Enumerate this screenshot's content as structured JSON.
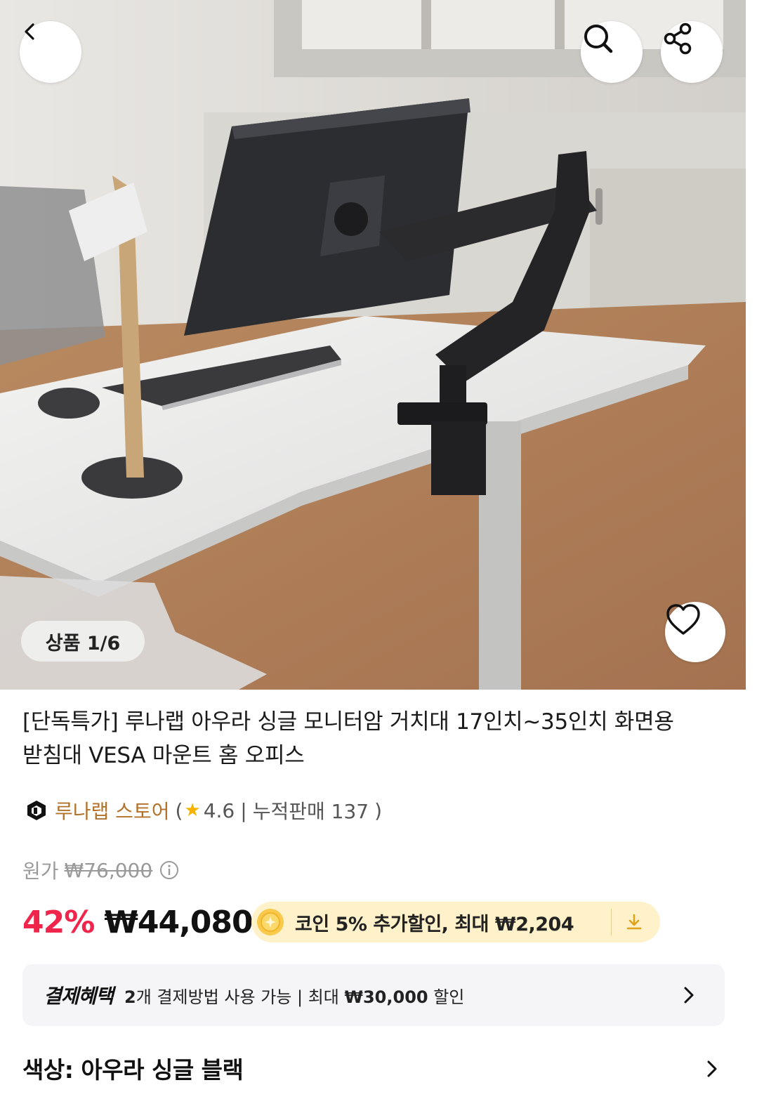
{
  "gallery": {
    "page_indicator": "상품 1/6",
    "icons": {
      "back": "back-arrow-icon",
      "search": "search-icon",
      "share": "share-icon",
      "wishlist": "heart-icon"
    }
  },
  "product": {
    "title_line1": "[단독특가] 루나랩 아우라 싱글 모니터암 거치대 17인치~35인치 화면용",
    "title_line2": "받침대 VESA 마운트 홈 오피스",
    "store": {
      "name": "루나랩 스토어",
      "open_paren": "(",
      "rating": "4.6",
      "separator": "|",
      "sales": "누적판매 137",
      "close_paren": ")"
    },
    "original_price_label": "원가",
    "original_price": "₩76,000",
    "discount": "42%",
    "price": "₩44,080",
    "coin_offer": "코인 5% 추가할인, 최대 ₩2,204"
  },
  "payment_benefit": {
    "label": "결제혜택",
    "count": "2",
    "text_a": "개 결제방법 사용 가능 | 최대 ",
    "max_amount": "₩30,000",
    "text_b": " 할인"
  },
  "option": {
    "color_label": "색상: 아우라 싱글 블랙"
  },
  "colors": {
    "discount_red": "#f0254b",
    "store_brown": "#b3722a",
    "star_yellow": "#f6b400",
    "coin_bg": "#fff1c9",
    "benefit_bg": "#f5f5f7"
  }
}
